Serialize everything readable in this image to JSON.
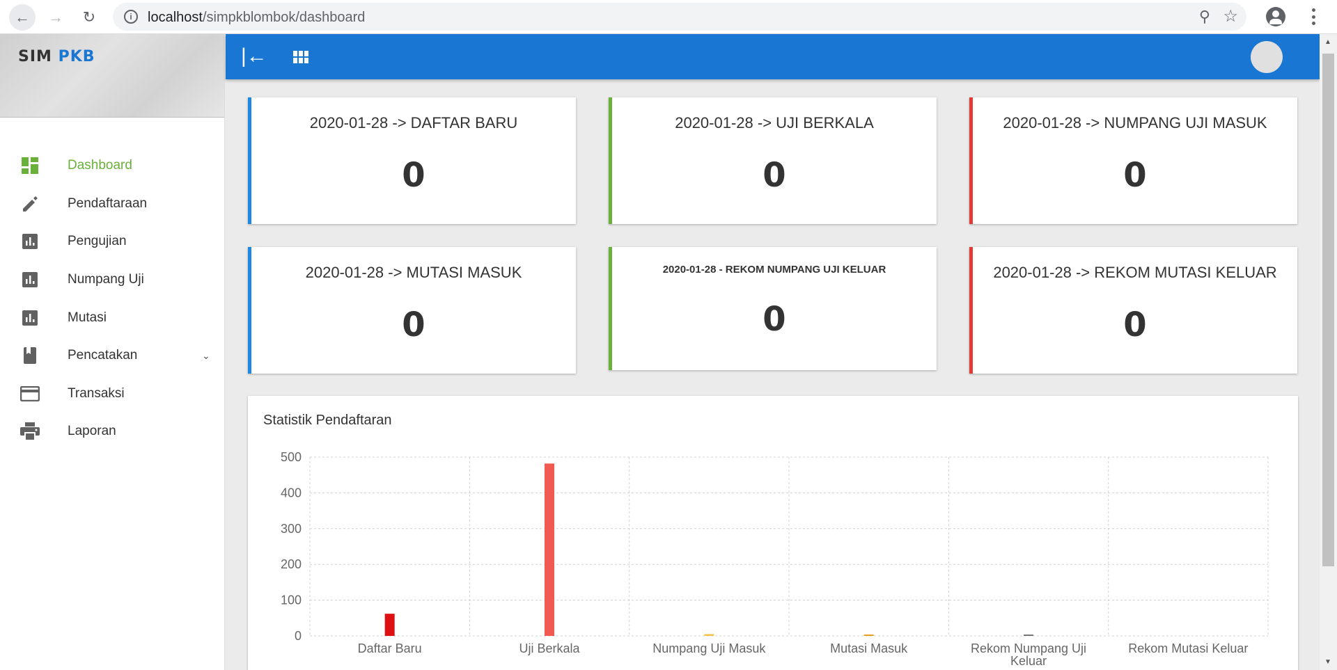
{
  "browser": {
    "url_host": "localhost",
    "url_path": "/simpkblombok/dashboard"
  },
  "brand": {
    "part1": "SIM",
    "part2": "PKB"
  },
  "sidebar": {
    "items": [
      {
        "label": "Dashboard",
        "icon": "dashboard-icon",
        "active": true
      },
      {
        "label": "Pendaftaraan",
        "icon": "pencil-icon"
      },
      {
        "label": "Pengujian",
        "icon": "bar-chart-icon"
      },
      {
        "label": "Numpang Uji",
        "icon": "bar-chart-icon"
      },
      {
        "label": "Mutasi",
        "icon": "bar-chart-icon"
      },
      {
        "label": "Pencatakan",
        "icon": "book-icon",
        "expandable": true
      },
      {
        "label": "Transaksi",
        "icon": "credit-card-icon"
      },
      {
        "label": "Laporan",
        "icon": "printer-icon"
      }
    ]
  },
  "cards": [
    {
      "title": "2020-01-28 -> DAFTAR BARU",
      "value": "0",
      "color": "#1e88e5"
    },
    {
      "title": "2020-01-28 -> UJI BERKALA",
      "value": "0",
      "color": "#6ab13c"
    },
    {
      "title": "2020-01-28 -> NUMPANG UJI MASUK",
      "value": "0",
      "color": "#e53935"
    },
    {
      "title": "2020-01-28 -> MUTASI MASUK",
      "value": "0",
      "color": "#1e88e5"
    },
    {
      "title": "2020-01-28 - REKOM NUMPANG UJI KELUAR",
      "value": "0",
      "color": "#6ab13c"
    },
    {
      "title": "2020-01-28 -> REKOM MUTASI KELUAR",
      "value": "0",
      "color": "#e53935"
    }
  ],
  "panel": {
    "title": "Statistik Pendaftaran"
  },
  "chart_data": {
    "type": "bar",
    "categories": [
      "Daftar Baru",
      "Uji Berkala",
      "Numpang Uji Masuk",
      "Mutasi Masuk",
      "Rekom Numpang Uji Keluar",
      "Rekom Mutasi Keluar"
    ],
    "values": [
      62,
      482,
      5,
      3,
      1,
      0
    ],
    "colors": [
      "#dd1111",
      "#f05a50",
      "#f7c24a",
      "#e6a01e",
      "#777777",
      "#999999"
    ],
    "ylim": [
      0,
      500
    ],
    "yticks": [
      0,
      100,
      200,
      300,
      400,
      500
    ],
    "grid": true
  }
}
